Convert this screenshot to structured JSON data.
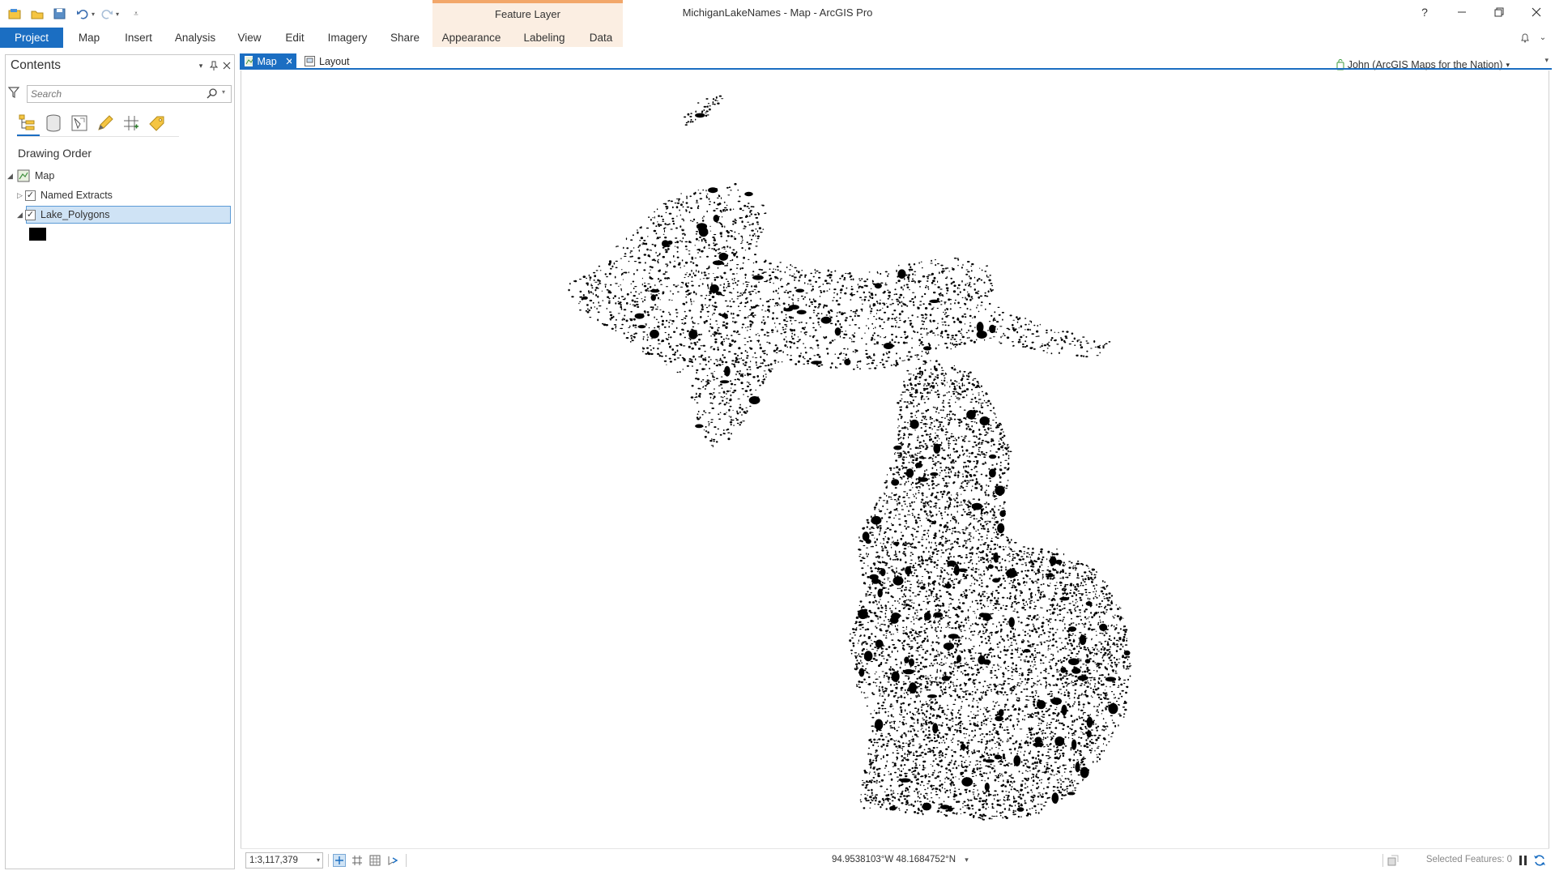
{
  "app": {
    "doc_title": "MichiganLakeNames - Map - ArcGIS Pro",
    "help": "?",
    "context_group": "Feature Layer"
  },
  "ribbon": {
    "tabs": [
      {
        "label": "Project",
        "active": true
      },
      {
        "label": "Map"
      },
      {
        "label": "Insert"
      },
      {
        "label": "Analysis"
      },
      {
        "label": "View"
      },
      {
        "label": "Edit"
      },
      {
        "label": "Imagery"
      },
      {
        "label": "Share"
      },
      {
        "label": "Appearance"
      },
      {
        "label": "Labeling"
      },
      {
        "label": "Data"
      }
    ],
    "user": "John (ArcGIS Maps for the Nation)"
  },
  "contents": {
    "title": "Contents",
    "search_placeholder": "Search",
    "section_title": "Drawing Order",
    "tree": {
      "map_label": "Map",
      "layers": [
        {
          "label": "Named Extracts",
          "checked": true,
          "expanded": false
        },
        {
          "label": "Lake_Polygons",
          "checked": true,
          "expanded": true,
          "selected": true
        }
      ]
    }
  },
  "views": {
    "tabs": [
      {
        "label": "Map",
        "active": true
      },
      {
        "label": "Layout"
      }
    ]
  },
  "status": {
    "scale": "1:3,117,379",
    "coordinates": "94.9538103°W 48.1684752°N",
    "selected_features": "Selected Features: 0"
  },
  "colors": {
    "accent": "#1b6ec2",
    "context_tab_bg": "#fbeee2",
    "context_tab_border": "#f2a76a",
    "lake_fill": "#000000"
  }
}
